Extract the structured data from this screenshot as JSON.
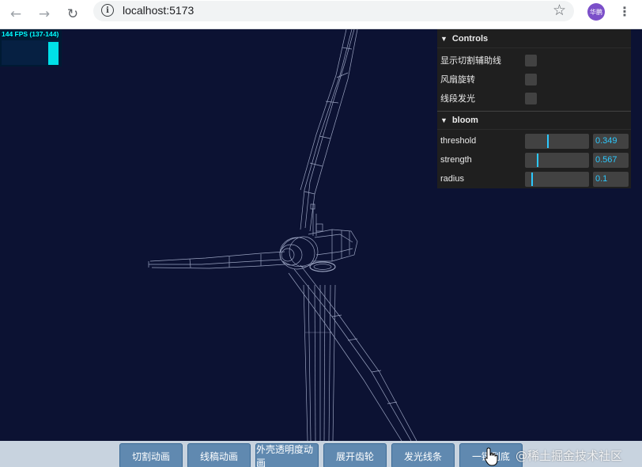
{
  "browser": {
    "url": "localhost:5173",
    "profile_initials": "华鹏",
    "icons": [
      "back-arrow-icon",
      "forward-arrow-icon",
      "reload-icon",
      "info-icon",
      "star-icon",
      "kebab-menu-icon"
    ]
  },
  "stats": {
    "label": "144 FPS (137-144)",
    "fps": 144
  },
  "gui": {
    "title": "Controls",
    "toggles": [
      {
        "label": "显示切割辅助线",
        "checked": false
      },
      {
        "label": "风扇旋转",
        "checked": false
      },
      {
        "label": "线段发光",
        "checked": false
      }
    ],
    "bloom": {
      "title": "bloom",
      "params": [
        {
          "label": "threshold",
          "value": "0.349",
          "fraction": 0.349
        },
        {
          "label": "strength",
          "value": "0.567",
          "fraction": 0.19
        },
        {
          "label": "radius",
          "value": "0.1",
          "fraction": 0.1
        }
      ]
    }
  },
  "buttons": [
    "切割动画",
    "线稿动画",
    "外壳透明度动画",
    "展开齿轮",
    "发光线条",
    "一键到底"
  ],
  "watermark": "@稀土掘金技术社区",
  "colors": {
    "scene_background": "#0c1233",
    "accent": "#2cc9ff",
    "button": "#6089b0",
    "wireframe": "#c8d2ee"
  }
}
